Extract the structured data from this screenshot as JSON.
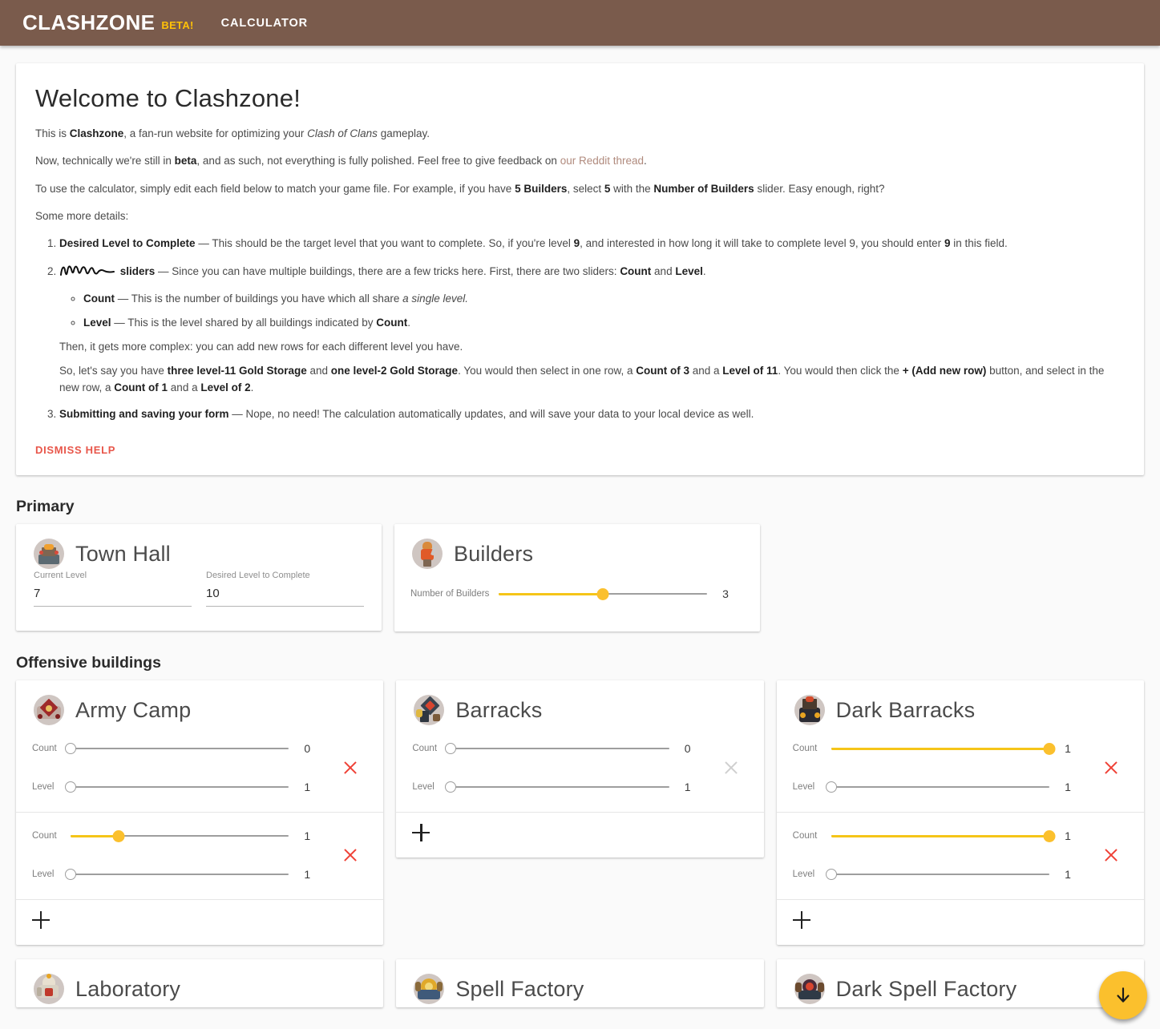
{
  "header": {
    "brand": "CLASHZONE",
    "beta": "BETA!",
    "nav_calculator": "CALCULATOR"
  },
  "help": {
    "title": "Welcome to Clashzone!",
    "p1_a": "This is ",
    "p1_b": "Clashzone",
    "p1_c": ", a fan-run website for optimizing your ",
    "p1_d": "Clash of Clans",
    "p1_e": " gameplay.",
    "p2_a": "Now, technically we're still in ",
    "p2_b": "beta",
    "p2_c": ", and as such, not everything is fully polished. Feel free to give feedback on ",
    "p2_link": "our Reddit thread",
    "p2_d": ".",
    "p3_a": "To use the calculator, simply edit each field below to match your game file. For example, if you have ",
    "p3_b": "5 Builders",
    "p3_c": ", select ",
    "p3_d": "5",
    "p3_e": " with the ",
    "p3_f": "Number of Builders",
    "p3_g": " slider. Easy enough, right?",
    "p4": "Some more details:",
    "item1_b": "Desired Level to Complete",
    "item1_a": " — This should be the target level that you want to complete. So, if you're level ",
    "item1_n1": "9",
    "item1_c": ", and interested in how long it will take to complete level 9, you should enter ",
    "item1_n2": "9",
    "item1_d": " in this field.",
    "item2_b": "sliders",
    "item2_a": " — Since you can have multiple buildings, there are a few tricks here. First, there are two sliders: ",
    "item2_c": "Count",
    "item2_d": " and ",
    "item2_e": "Level",
    "item2_f": ".",
    "sub1_b": "Count",
    "sub1_a": " — This is the number of buildings you have which all share ",
    "sub1_i": "a single level.",
    "sub2_b": "Level",
    "sub2_a": " — This is the level shared by all buildings indicated by ",
    "sub2_c": "Count",
    "sub2_d": ".",
    "item2_then": "Then, it gets more complex: you can add new rows for each different level you have.",
    "item2_eg_a": "So, let's say you have ",
    "item2_eg_b": "three level-11 Gold Storage",
    "item2_eg_c": " and ",
    "item2_eg_d": "one level-2 Gold Storage",
    "item2_eg_e": ". You would then select in one row, a ",
    "item2_eg_f": "Count of 3",
    "item2_eg_g": " and a ",
    "item2_eg_h": "Level of 11",
    "item2_eg_i": ". You would then click the ",
    "item2_eg_j": "+ (Add new row)",
    "item2_eg_k": " button, and select in the new row, a ",
    "item2_eg_l": "Count of 1",
    "item2_eg_m": " and a ",
    "item2_eg_n": "Level of 2",
    "item2_eg_o": ".",
    "item3_b": "Submitting and saving your form",
    "item3_a": " — Nope, no need! The calculation automatically updates, and will save your data to your local device as well.",
    "dismiss": "DISMISS HELP"
  },
  "sections": {
    "primary": "Primary",
    "offensive": "Offensive buildings"
  },
  "town_hall": {
    "title": "Town Hall",
    "icon": "town-hall-icon",
    "current_level_label": "Current Level",
    "current_level_value": "7",
    "desired_level_label": "Desired Level to Complete",
    "desired_level_value": "10"
  },
  "builders": {
    "title": "Builders",
    "icon": "builder-icon",
    "slider_label": "Number of Builders",
    "value": "3",
    "fill_percent": 50
  },
  "buildings": [
    {
      "title": "Army Camp",
      "icon": "army-camp-icon",
      "rows": [
        {
          "count_label": "Count",
          "count_value": "0",
          "count_fill": 0,
          "count_on": false,
          "level_label": "Level",
          "level_value": "1",
          "level_fill": 0,
          "level_on": false,
          "remove_enabled": true
        },
        {
          "count_label": "Count",
          "count_value": "1",
          "count_fill": 22,
          "count_on": true,
          "level_label": "Level",
          "level_value": "1",
          "level_fill": 0,
          "level_on": false,
          "remove_enabled": true
        }
      ],
      "add_label": "+"
    },
    {
      "title": "Barracks",
      "icon": "barracks-icon",
      "rows": [
        {
          "count_label": "Count",
          "count_value": "0",
          "count_fill": 0,
          "count_on": false,
          "level_label": "Level",
          "level_value": "1",
          "level_fill": 0,
          "level_on": false,
          "remove_enabled": false
        }
      ],
      "add_label": "+"
    },
    {
      "title": "Dark Barracks",
      "icon": "dark-barracks-icon",
      "rows": [
        {
          "count_label": "Count",
          "count_value": "1",
          "count_fill": 100,
          "count_on": true,
          "level_label": "Level",
          "level_value": "1",
          "level_fill": 0,
          "level_on": false,
          "remove_enabled": true
        },
        {
          "count_label": "Count",
          "count_value": "1",
          "count_fill": 100,
          "count_on": true,
          "level_label": "Level",
          "level_value": "1",
          "level_fill": 0,
          "level_on": false,
          "remove_enabled": true
        }
      ],
      "add_label": "+"
    }
  ],
  "buildings_bottom": [
    {
      "title": "Laboratory",
      "icon": "laboratory-icon"
    },
    {
      "title": "Spell Factory",
      "icon": "spell-factory-icon"
    },
    {
      "title": "Dark Spell Factory",
      "icon": "dark-spell-factory-icon"
    }
  ],
  "fab": {
    "icon": "arrow-down-icon",
    "color": "#fbc02d"
  },
  "colors": {
    "appbar": "#7a5b4c",
    "accent": "#fbc02d",
    "danger": "#ef4136",
    "dismiss": "#e8564a",
    "link": "#b08a7d"
  }
}
